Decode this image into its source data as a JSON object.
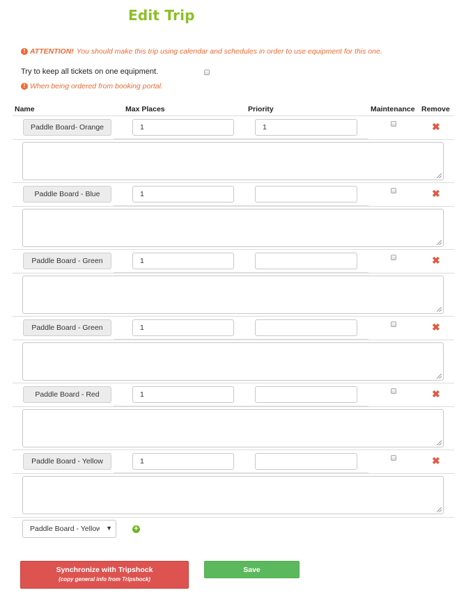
{
  "page": {
    "title": "Edit Trip"
  },
  "attention": {
    "icon": "exclamation-circle-icon",
    "label": "ATTENTION!",
    "text": "You should make this trip using calendar and schedules in order to use equipment for this one."
  },
  "keep_tickets": {
    "label": "Try to keep all tickets on one equipment.",
    "checked": false,
    "note": "When being ordered from booking portal."
  },
  "columns": [
    "Name",
    "Max Places",
    "Priority",
    "Maintenance",
    "Remove"
  ],
  "equipment_rows": [
    {
      "name": "Paddle Board- Orange",
      "max_places": "1",
      "priority": "1",
      "maintenance": false,
      "notes": ""
    },
    {
      "name": "Paddle Board - Blue",
      "max_places": "1",
      "priority": "",
      "maintenance": false,
      "notes": ""
    },
    {
      "name": "Paddle Board - Green",
      "max_places": "1",
      "priority": "",
      "maintenance": false,
      "notes": ""
    },
    {
      "name": "Paddle Board - Green",
      "max_places": "1",
      "priority": "",
      "maintenance": false,
      "notes": ""
    },
    {
      "name": "Paddle Board - Red",
      "max_places": "1",
      "priority": "",
      "maintenance": false,
      "notes": ""
    },
    {
      "name": "Paddle Board - Yellow",
      "max_places": "1",
      "priority": "",
      "maintenance": false,
      "notes": ""
    }
  ],
  "add_equipment": {
    "selected": "Paddle Board - Yellow",
    "add_icon": "plus-circle-icon"
  },
  "buttons": {
    "sync_label": "Synchronize with Tripshock",
    "sync_sublabel": "(copy general info from Tripshock)",
    "save_label": "Save"
  },
  "colors": {
    "title": "#8cbf26",
    "warning": "#ea6b35",
    "remove": "#e05a44",
    "sync": "#dc534f",
    "save": "#5cb85c"
  }
}
